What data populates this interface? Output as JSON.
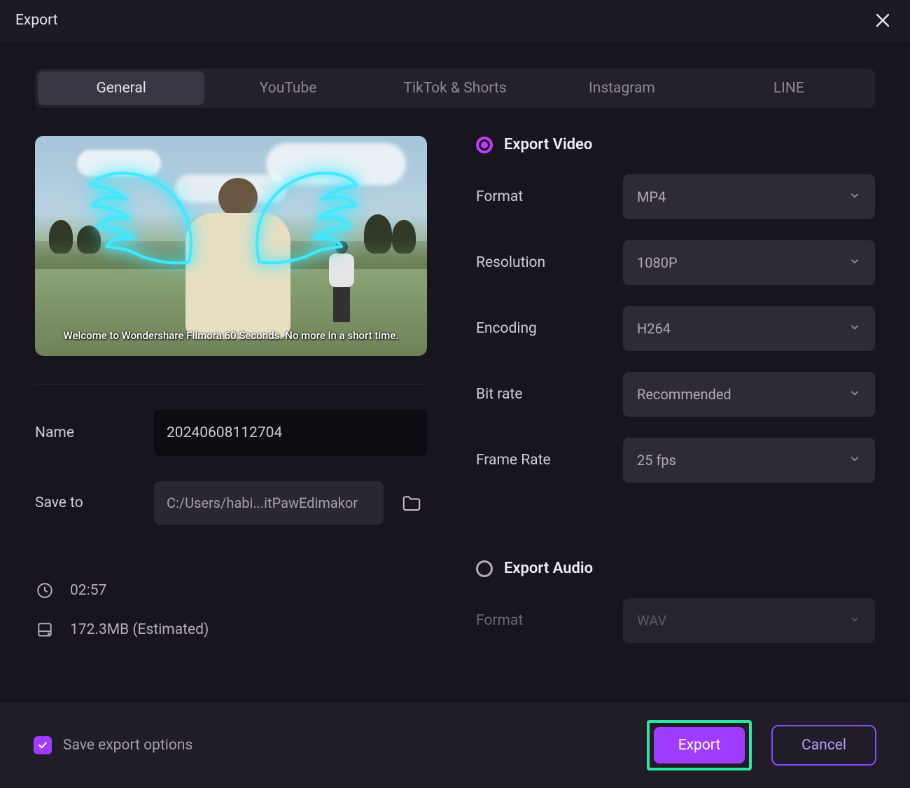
{
  "window": {
    "title": "Export"
  },
  "tabs": [
    {
      "label": "General",
      "active": true
    },
    {
      "label": "YouTube",
      "active": false
    },
    {
      "label": "TikTok & Shorts",
      "active": false
    },
    {
      "label": "Instagram",
      "active": false
    },
    {
      "label": "LINE",
      "active": false
    }
  ],
  "preview": {
    "caption": "Welcome to Wondershare Filmora 60 Seconds. No more in a short time."
  },
  "file": {
    "name_label": "Name",
    "name_value": "20240608112704",
    "save_to_label": "Save to",
    "save_to_path": "C:/Users/habi...itPawEdimakor"
  },
  "stats": {
    "duration": "02:57",
    "size": "172.3MB (Estimated)"
  },
  "export_video": {
    "heading": "Export Video",
    "selected": true,
    "settings": {
      "format": {
        "label": "Format",
        "value": "MP4"
      },
      "resolution": {
        "label": "Resolution",
        "value": "1080P"
      },
      "encoding": {
        "label": "Encoding",
        "value": "H264"
      },
      "bitrate": {
        "label": "Bit rate",
        "value": "Recommended"
      },
      "framerate": {
        "label": "Frame Rate",
        "value": "25  fps"
      }
    }
  },
  "export_audio": {
    "heading": "Export Audio",
    "selected": false,
    "settings": {
      "format": {
        "label": "Format",
        "value": "WAV"
      }
    }
  },
  "footer": {
    "save_options_label": "Save export options",
    "save_options_checked": true,
    "export_label": "Export",
    "cancel_label": "Cancel"
  },
  "colors": {
    "accent": "#a03cff",
    "highlight_border": "#2be6a4",
    "radio_accent": "#c03cff"
  }
}
